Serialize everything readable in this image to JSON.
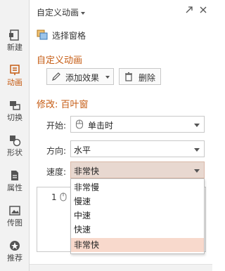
{
  "rail": {
    "items": [
      {
        "label": "新建",
        "icon": "new-icon"
      },
      {
        "label": "动画",
        "icon": "animation-icon",
        "active": true
      },
      {
        "label": "切换",
        "icon": "transition-icon"
      },
      {
        "label": "形状",
        "icon": "shape-icon"
      },
      {
        "label": "属性",
        "icon": "properties-icon"
      },
      {
        "label": "传图",
        "icon": "upload-image-icon"
      },
      {
        "label": "推荐",
        "icon": "recommend-icon"
      }
    ]
  },
  "header": {
    "title": "自定义动画",
    "select_pane_label": "选择窗格"
  },
  "custom_animation": {
    "section_title": "自定义动画",
    "add_effect_label": "添加效果",
    "delete_label": "删除"
  },
  "modify": {
    "section_title": "修改: 百叶窗",
    "start_label": "开始:",
    "start_value": "单击时",
    "direction_label": "方向:",
    "direction_value": "水平",
    "speed_label": "速度:",
    "speed_value": "非常快"
  },
  "animation_list": {
    "items": [
      {
        "number": "1"
      }
    ]
  },
  "speed_dropdown": {
    "options": [
      "非常慢",
      "慢速",
      "中速",
      "快速",
      "非常快"
    ],
    "selected": "非常快"
  },
  "colors": {
    "accent": "#c55a11",
    "selected_bg": "#f8d9cc"
  }
}
